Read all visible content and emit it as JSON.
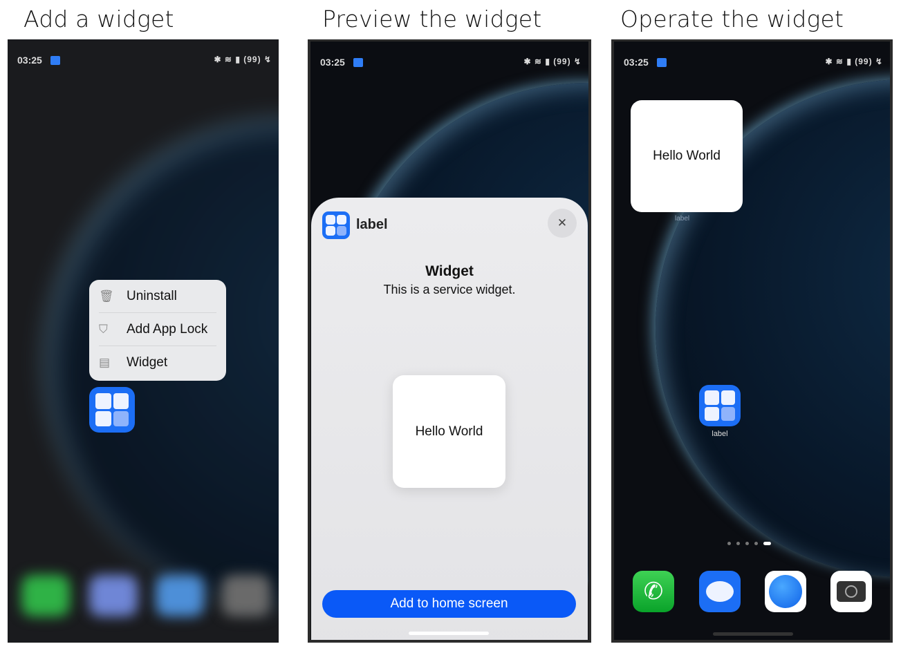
{
  "panels": [
    {
      "title": "Add a widget"
    },
    {
      "title": "Preview the widget"
    },
    {
      "title": "Operate the widget"
    }
  ],
  "status_bar": {
    "time": "03:25",
    "indicators": "✱ ≋ ▮ (99) ↯",
    "battery": "99"
  },
  "context_menu": {
    "items": [
      {
        "label": "Uninstall",
        "icon": "trash-icon"
      },
      {
        "label": "Add App Lock",
        "icon": "shield-icon"
      },
      {
        "label": "Widget",
        "icon": "widget-icon"
      }
    ]
  },
  "preview_sheet": {
    "app_name": "label",
    "close": "✕",
    "widget_title": "Widget",
    "widget_description": "This is a service widget.",
    "widget_content": "Hello World",
    "add_button": "Add to home screen",
    "accent": "#0a59f7"
  },
  "home_screen": {
    "widget_content": "Hello World",
    "widget_label": "label",
    "app_label": "label",
    "page_count": 5,
    "current_page": 5,
    "dock": [
      "phone-icon",
      "messages-icon",
      "browser-icon",
      "camera-icon"
    ]
  }
}
